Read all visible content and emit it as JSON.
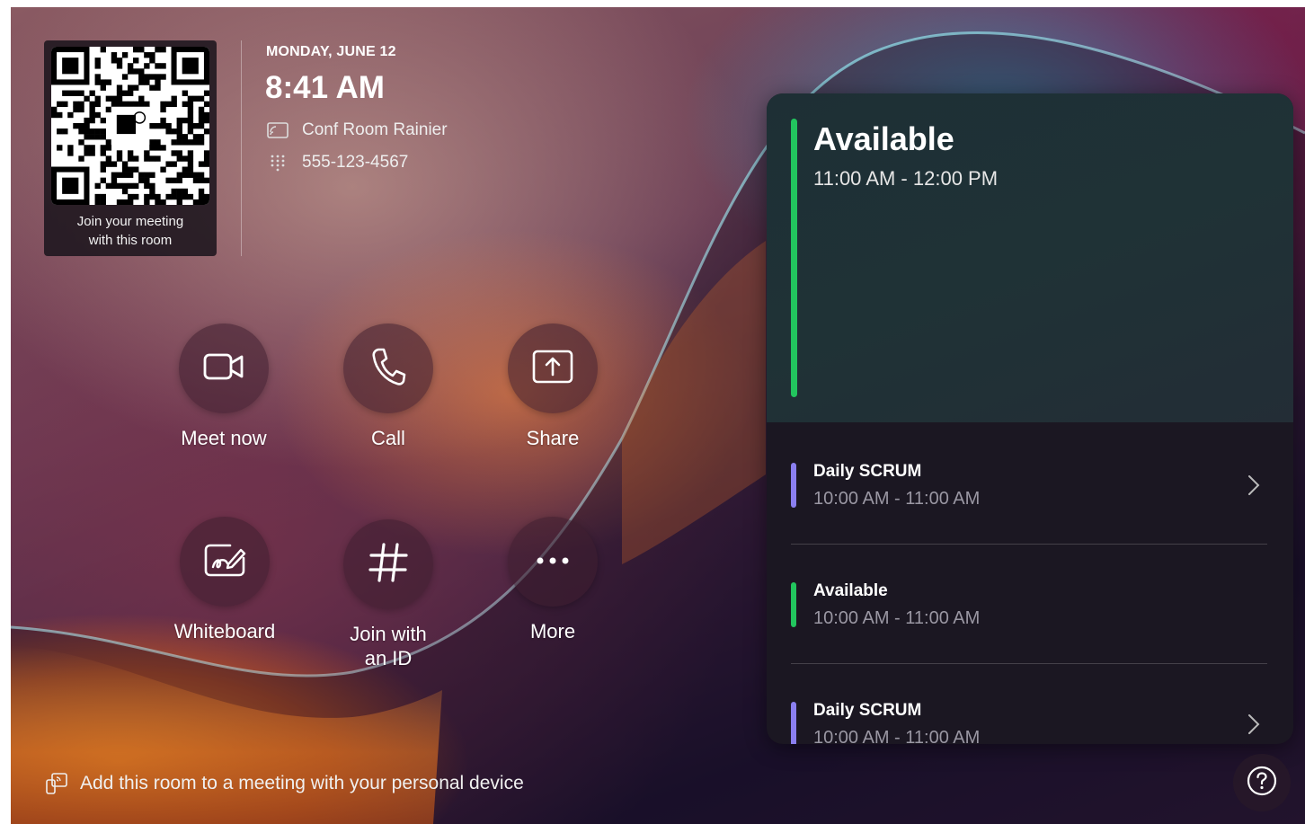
{
  "room": {
    "qr_caption_line1": "Join your meeting",
    "qr_caption_line2": "with this room",
    "date": "MONDAY, JUNE 12",
    "time": "8:41 AM",
    "name": "Conf Room Rainier",
    "phone": "555-123-4567"
  },
  "actions": [
    {
      "label": "Meet now",
      "icon": "video-camera-icon"
    },
    {
      "label": "Call",
      "icon": "phone-icon"
    },
    {
      "label": "Share",
      "icon": "share-screen-icon"
    },
    {
      "label": "Whiteboard",
      "icon": "whiteboard-icon"
    },
    {
      "label": "Join with an ID",
      "label_line1": "Join with",
      "label_line2": "an ID",
      "icon": "hash-icon"
    },
    {
      "label": "More",
      "icon": "more-dots-icon"
    }
  ],
  "calendar": {
    "current_status": "Available",
    "current_range": "11:00 AM - 12:00 PM",
    "meetings": [
      {
        "title": "Daily SCRUM",
        "range": "10:00 AM - 11:00 AM",
        "color": "#8b7ff0"
      },
      {
        "title": "Available",
        "range": "10:00 AM - 11:00 AM",
        "color": "#22c55e"
      },
      {
        "title": "Daily SCRUM",
        "range": "10:00 AM - 11:00 AM",
        "color": "#8b7ff0"
      }
    ]
  },
  "footer": {
    "hint": "Add this room to a meeting with your personal device"
  },
  "colors": {
    "available_green": "#22c55e",
    "meeting_purple": "#8b7ff0",
    "panel_bg": "#1b1722"
  }
}
